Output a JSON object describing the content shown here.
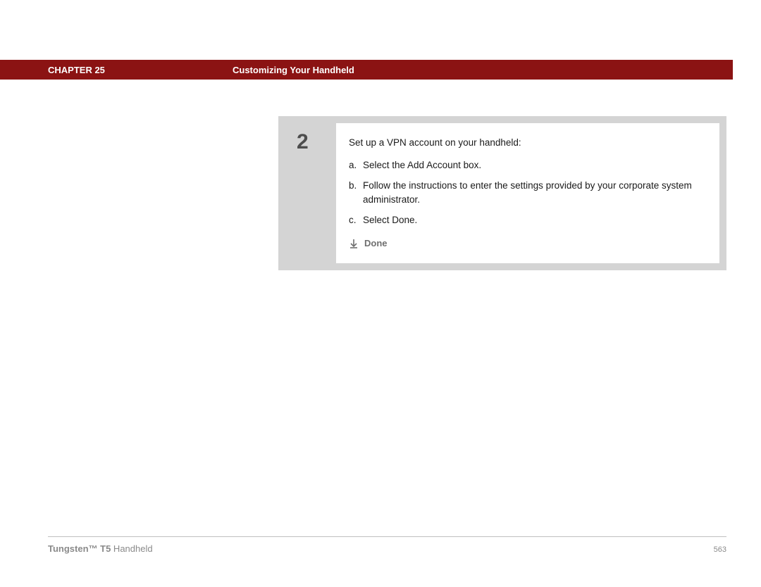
{
  "header": {
    "chapter_label": "CHAPTER 25",
    "title": "Customizing Your Handheld"
  },
  "step": {
    "number": "2",
    "intro": "Set up a VPN account on your handheld:",
    "items": [
      {
        "marker": "a.",
        "text": "Select the Add Account box."
      },
      {
        "marker": "b.",
        "text": "Follow the instructions to enter the settings provided by your corporate system administrator."
      },
      {
        "marker": "c.",
        "text": "Select Done."
      }
    ],
    "done_label": "Done"
  },
  "footer": {
    "product_bold": "Tungsten™ T5",
    "product_rest": " Handheld",
    "page_number": "563"
  }
}
